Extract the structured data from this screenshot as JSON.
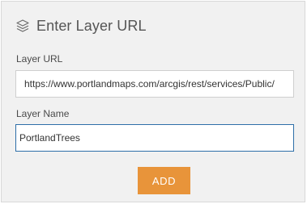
{
  "dialog": {
    "title": "Enter Layer URL",
    "icon": "layers-icon"
  },
  "form": {
    "url_label": "Layer URL",
    "url_value": "https://www.portlandmaps.com/arcgis/rest/services/Public/",
    "name_label": "Layer Name",
    "name_value": "PortlandTrees"
  },
  "actions": {
    "add_label": "ADD"
  },
  "colors": {
    "accent": "#e8943a",
    "panel_bg": "#f1f1f1",
    "focus_border": "#2d6ea8"
  }
}
